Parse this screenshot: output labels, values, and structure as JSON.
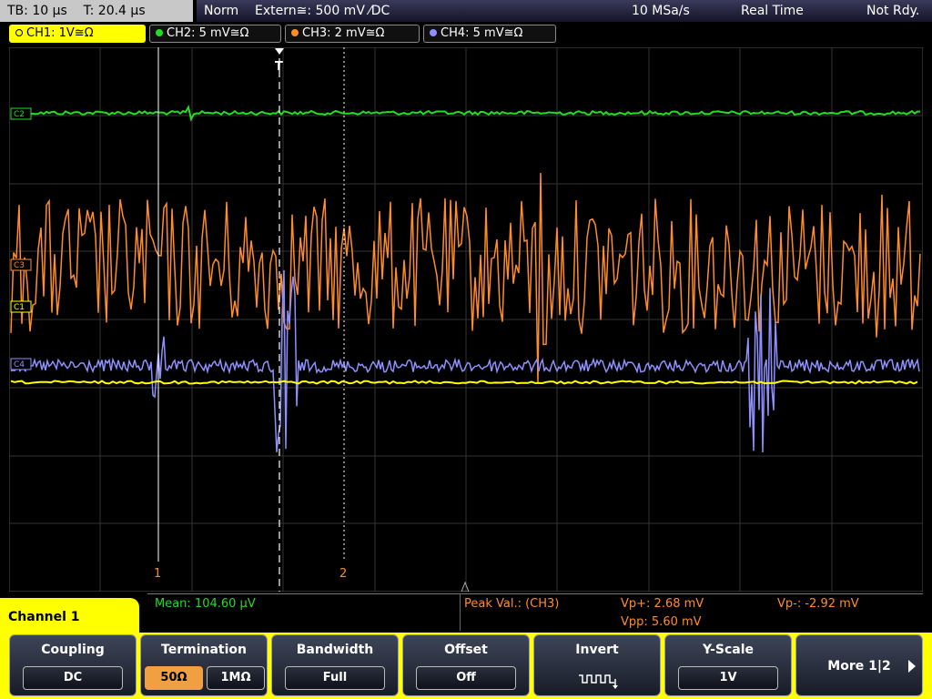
{
  "topbar": {
    "timebase": "TB: 10 µs",
    "trigger_time": "T: 20.4 µs",
    "trigger_mode": "Norm",
    "trigger_source": "Extern≅: 500 mV ⁄DC",
    "sample_rate": "10 MSa/s",
    "acq_mode": "Real Time",
    "status": "Not Rdy."
  },
  "channels": [
    {
      "label": "CH1: 1V≅Ω",
      "color": "#ffff00"
    },
    {
      "label": "CH2: 5 mV≅Ω",
      "color": "#22dd22"
    },
    {
      "label": "CH3: 2 mV≅Ω",
      "color": "#ff8c2a"
    },
    {
      "label": "CH4: 5 mV≅Ω",
      "color": "#8f8fff"
    }
  ],
  "plot": {
    "trigger_marker": "T",
    "cursor1_label": "1",
    "cursor2_label": "2",
    "ch_markers": [
      "C2",
      "C3",
      "C1",
      "C4"
    ]
  },
  "measurements": {
    "mean": "Mean: 104.60 µV",
    "peak_label": "Peak Val.:  (CH3)",
    "vp_plus": "Vp+: 2.68 mV",
    "vp_minus": "Vp-: -2.92 mV",
    "vpp": "Vpp: 5.60 mV"
  },
  "menu": {
    "title": "Channel 1",
    "coupling": {
      "title": "Coupling",
      "value": "DC"
    },
    "termination": {
      "title": "Termination",
      "opt1": "50Ω",
      "opt2": "1MΩ"
    },
    "bandwidth": {
      "title": "Bandwidth",
      "value": "Full"
    },
    "offset": {
      "title": "Offset",
      "value": "Off"
    },
    "invert": {
      "title": "Invert"
    },
    "yscale": {
      "title": "Y-Scale",
      "value": "1V"
    },
    "more": "More 1|2"
  }
}
